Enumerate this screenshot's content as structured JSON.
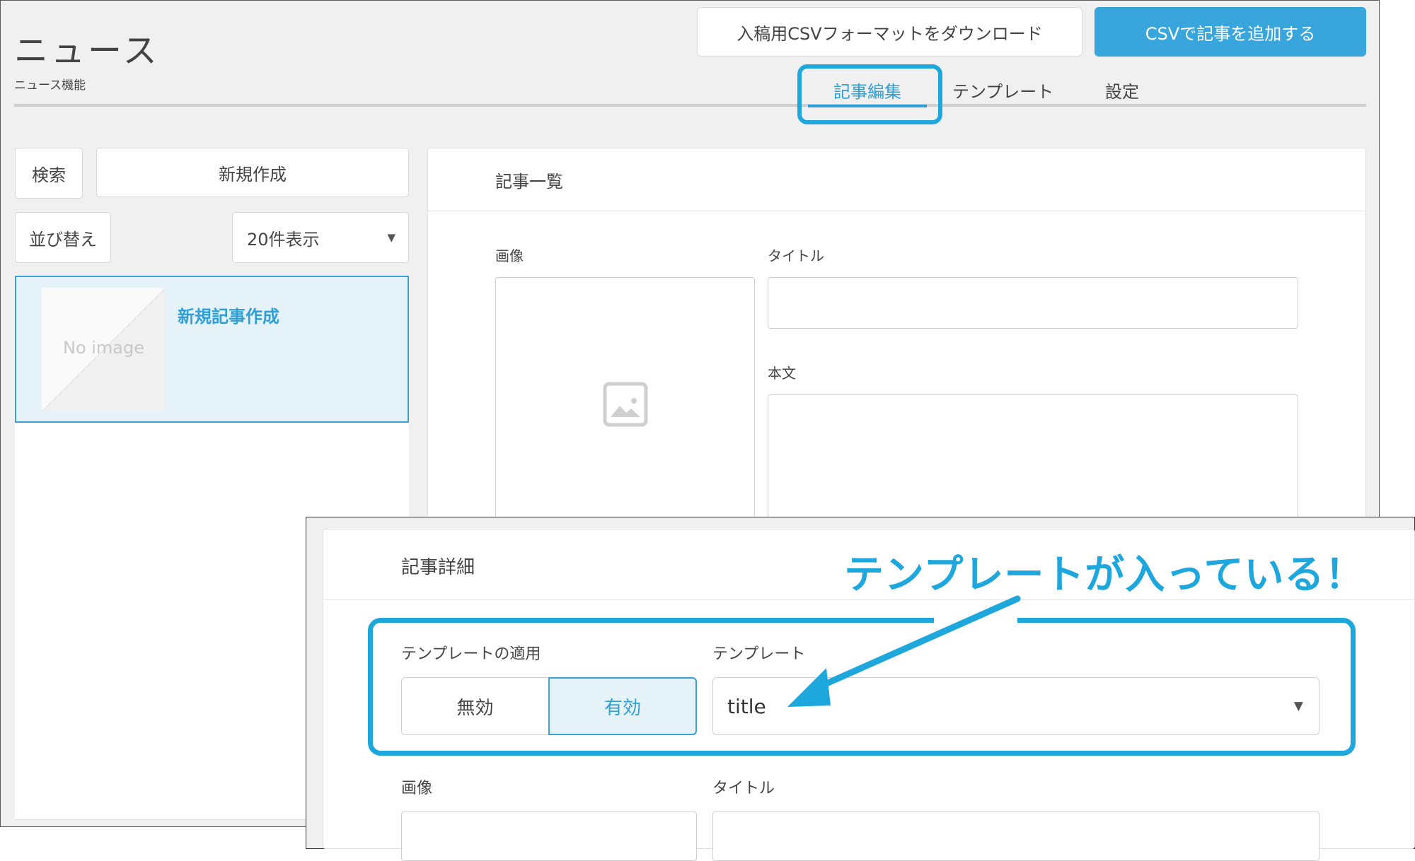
{
  "header": {
    "title": "ニュース",
    "subtitle": "ニュース機能",
    "csv_format_download_label": "入稿用CSVフォーマットをダウンロード",
    "csv_add_article_label": "CSVで記事を追加する"
  },
  "tabs": [
    {
      "label": "記事編集",
      "active": true
    },
    {
      "label": "テンプレート",
      "active": false
    },
    {
      "label": "設定",
      "active": false
    }
  ],
  "sidebar": {
    "search_label": "検索",
    "new_label": "新規作成",
    "sort_label": "並び替え",
    "per_page_value": "20件表示",
    "items": [
      {
        "thumbnail_text": "No image",
        "title": "新規記事作成",
        "selected": true
      }
    ]
  },
  "article_panel": {
    "title": "記事一覧",
    "image_label": "画像",
    "title_label": "タイトル",
    "body_label": "本文"
  },
  "detail_panel": {
    "title": "記事詳細",
    "annotation": "テンプレートが入っている！",
    "template_apply_label": "テンプレートの適用",
    "toggle_off_label": "無効",
    "toggle_on_label": "有効",
    "toggle_selected": "有効",
    "template_label": "テンプレート",
    "template_value": "title",
    "image_label": "画像",
    "title_label": "タイトル"
  },
  "colors": {
    "accent": "#2f9fd6",
    "highlight": "#1ea7dd",
    "primary_button": "#38a6dc",
    "selected_bg": "#e5f2f8",
    "page_bg": "#f0f0f0"
  },
  "icons": {
    "image_placeholder": "image-icon",
    "dropdown": "caret-down-icon",
    "annotation_arrow": "arrow-icon"
  }
}
